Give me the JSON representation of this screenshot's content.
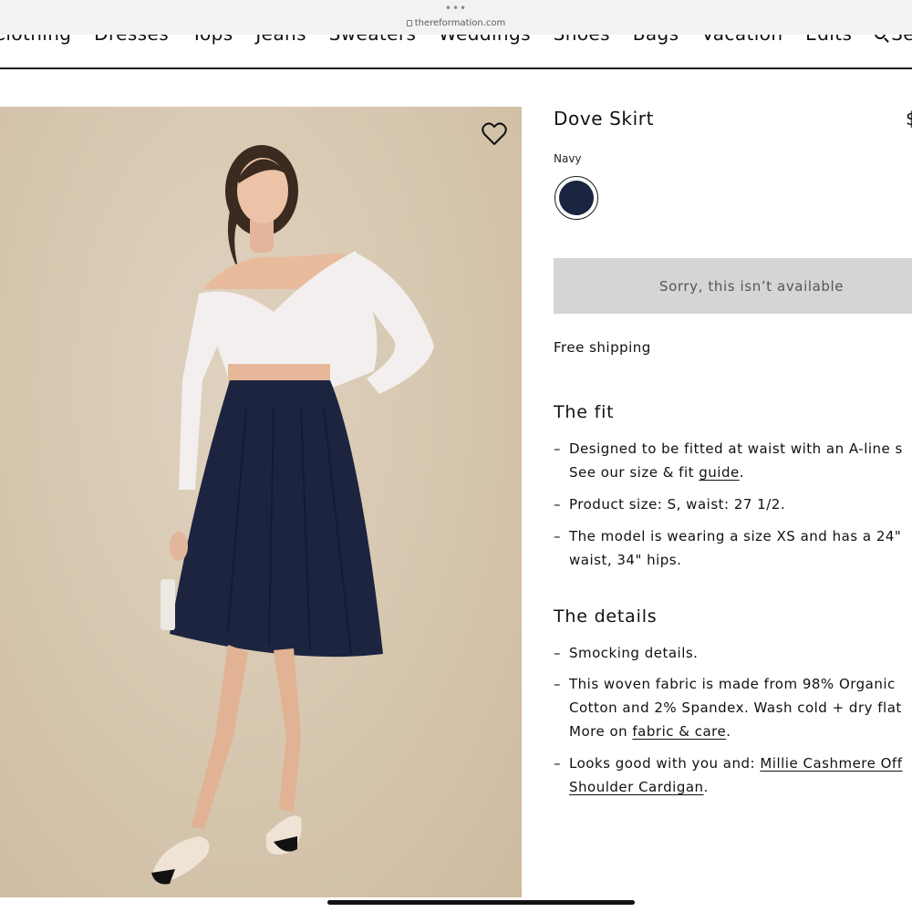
{
  "browser": {
    "url": "thereformation.com",
    "menu_dots": "•••"
  },
  "nav": {
    "items": [
      "Clothing",
      "Dresses",
      "Tops",
      "Jeans",
      "Sweaters",
      "Weddings",
      "Shoes",
      "Bags",
      "Vacation",
      "Edits"
    ],
    "search_label": "Search",
    "search_icon": "search-icon"
  },
  "product": {
    "title": "Dove Skirt",
    "price_visible": "$",
    "color_label": "Navy",
    "swatch_color": "#1b2540",
    "wishlist_icon": "heart-icon",
    "availability_button": "Sorry, this isn’t available",
    "shipping": "Free shipping"
  },
  "fit": {
    "heading": "The fit",
    "bullets": {
      "b1_line1": "Designed to be fitted at waist with an A-line s",
      "b1_line2_pre": "See our size & fit ",
      "b1_link": "guide",
      "b1_line2_post": ".",
      "b2": "Product size: S, waist: 27 1/2.",
      "b3_line1": "The model is wearing a size XS and has a 24\"",
      "b3_line2": "waist, 34\" hips."
    }
  },
  "details": {
    "heading": "The details",
    "bullets": {
      "d1": "Smocking details.",
      "d2_line1": "This woven fabric is made from 98% Organic",
      "d2_line2": "Cotton and 2% Spandex. Wash cold + dry flat",
      "d2_line3_pre": "More on ",
      "d2_link": "fabric & care",
      "d2_line3_post": ".",
      "d3_line1_pre": "Looks good with you and: ",
      "d3_link_line1": "Millie Cashmere Off",
      "d3_link_line2": "Shoulder Cardigan",
      "d3_line2_post": "."
    }
  },
  "dash": "–"
}
